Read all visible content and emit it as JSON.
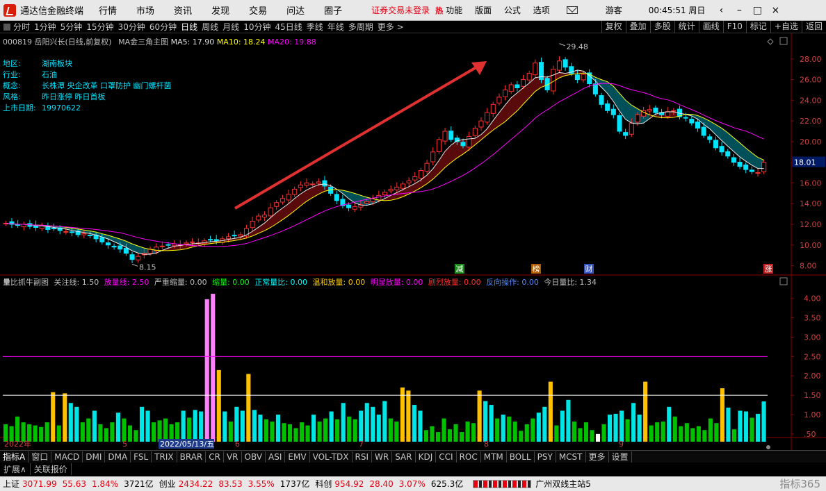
{
  "titlebar": {
    "app_title": "通达信金融终端",
    "menu": [
      "行情",
      "市场",
      "资讯",
      "发现",
      "交易",
      "问达",
      "圈子"
    ],
    "warning": "证券交易未登录",
    "hot_label": "热",
    "tools": [
      "功能",
      "版面",
      "公式",
      "选项"
    ],
    "guest": "游客",
    "clock": "00:45:51 周日",
    "window_buttons": [
      "‹",
      "–",
      "□",
      "×"
    ]
  },
  "periodbar": {
    "periods": [
      "分时",
      "1分钟",
      "5分钟",
      "15分钟",
      "30分钟",
      "60分钟",
      "日线",
      "周线",
      "月线",
      "10分钟",
      "45日线",
      "季线",
      "年线",
      "多周期",
      "更多 >"
    ],
    "selected": "日线",
    "right": [
      "复权",
      "叠加",
      "多股",
      "统计",
      "画线",
      "F10",
      "标记",
      "+自选",
      "返回"
    ]
  },
  "main_header": {
    "code_name": "000819 岳阳兴长(日线,前复权)",
    "indicator": "MA金三角主图",
    "ma5": "MA5: 17.90",
    "ma10": "MA10: 18.24",
    "ma20": "MA20: 19.88"
  },
  "info": [
    {
      "k": "地区:",
      "v": "湖南板块"
    },
    {
      "k": "行业:",
      "v": "石油"
    },
    {
      "k": "概念:",
      "v": "长株潭 央企改革 口罩防护 幽门螺杆菌"
    },
    {
      "k": "风格:",
      "v": "昨日涨停 昨日首板"
    },
    {
      "k": "上市日期:",
      "v": "19970622"
    }
  ],
  "price_axis": [
    "28.00",
    "26.00",
    "24.00",
    "22.00",
    "20.00",
    "18.00",
    "16.00",
    "14.00",
    "12.00",
    "10.00",
    "8.00"
  ],
  "current_price": "18.01",
  "high_mark": "29.48",
  "low_mark": "8.15",
  "event_badges": [
    "减",
    "榜",
    "财",
    "涨"
  ],
  "sub_header": {
    "name": "量比抓牛副图",
    "items": [
      {
        "text": "关注线: 1.50",
        "color": "#c0c0c0"
      },
      {
        "text": "放量线: 2.50",
        "color": "#ff00ff"
      },
      {
        "text": "严重缩量: 0.00",
        "color": "#c0c0c0"
      },
      {
        "text": "缩量: 0.00",
        "color": "#00ff00"
      },
      {
        "text": "正常量比: 0.00",
        "color": "#00ffff"
      },
      {
        "text": "温和放量: 0.00",
        "color": "#ffcc00"
      },
      {
        "text": "明显放量: 0.00",
        "color": "#ff00ff"
      },
      {
        "text": "剧烈放量: 0.00",
        "color": "#ff3030"
      },
      {
        "text": "反向操作: 0.00",
        "color": "#5588ff"
      },
      {
        "text": "今日量比: 1.34",
        "color": "#c0c0c0"
      }
    ]
  },
  "vol_axis": [
    "4.00",
    "3.50",
    "3.00",
    "2.50",
    "2.00",
    "1.50",
    "1.00",
    ".50"
  ],
  "date_axis": [
    "2022年",
    "5",
    "2022/05/13/五",
    "6",
    "7",
    "8",
    "9"
  ],
  "tabs": [
    "指标A",
    "窗口",
    "MACD",
    "DMI",
    "DMA",
    "FSL",
    "TRIX",
    "BRAR",
    "CR",
    "VR",
    "OBV",
    "ASI",
    "EMV",
    "VOL-TDX",
    "RSI",
    "WR",
    "SAR",
    "KDJ",
    "CCI",
    "ROC",
    "MTM",
    "BOLL",
    "PSY",
    "MCST",
    "更多",
    "设置"
  ],
  "ext": [
    "扩展∧",
    "关联报价"
  ],
  "status": {
    "sh_label": "上证",
    "sh_val": "3071.99",
    "sh_chg": "55.63",
    "sh_pct": "1.84%",
    "sh_amt": "3721亿",
    "cy_label": "创业",
    "cy_val": "2434.22",
    "cy_chg": "83.53",
    "cy_pct": "3.55%",
    "cy_amt": "1737亿",
    "kc_label": "科创",
    "kc_val": "954.92",
    "kc_chg": "28.40",
    "kc_pct": "3.07%",
    "kc_amt": "625.3亿",
    "server": "广州双线主站5",
    "watermark": "指标365"
  },
  "chart_data": {
    "type": "candlestick",
    "ylim": [
      7.5,
      29.8
    ],
    "candles_note": "close values (approximate) per trading day, Apr–Sep 2022",
    "closes": [
      12.1,
      12.0,
      11.9,
      12.0,
      11.8,
      11.7,
      11.9,
      11.5,
      11.6,
      11.4,
      11.3,
      11.2,
      11.0,
      11.1,
      10.9,
      10.6,
      10.3,
      10.0,
      9.8,
      9.6,
      9.2,
      8.6,
      8.9,
      9.2,
      9.6,
      9.8,
      9.9,
      10.0,
      10.1,
      10.0,
      10.2,
      10.3,
      10.2,
      10.4,
      10.5,
      10.4,
      10.6,
      10.8,
      10.9,
      11.0,
      11.6,
      12.3,
      12.8,
      12.9,
      13.6,
      14.1,
      14.5,
      14.9,
      15.4,
      15.8,
      16.0,
      15.9,
      16.1,
      15.7,
      15.0,
      14.3,
      13.8,
      13.6,
      13.7,
      13.9,
      14.2,
      14.5,
      14.8,
      15.1,
      15.4,
      15.6,
      15.9,
      16.2,
      16.6,
      17.2,
      17.9,
      19.0,
      20.2,
      21.0,
      20.2,
      20.0,
      19.6,
      20.5,
      21.3,
      22.0,
      22.8,
      23.6,
      24.3,
      25.0,
      25.5,
      25.2,
      26.0,
      26.6,
      27.6,
      26.0,
      25.0,
      27.0,
      27.8,
      27.2,
      26.6,
      26.0,
      26.5,
      25.6,
      24.6,
      23.6,
      23.0,
      22.6,
      21.0,
      20.6,
      21.8,
      22.6,
      23.0,
      23.1,
      22.8,
      22.6,
      22.9,
      23.0,
      22.4,
      22.3,
      21.8,
      21.3,
      20.6,
      20.2,
      19.4,
      19.0,
      18.6,
      18.0,
      17.6,
      17.3,
      17.1,
      17.0,
      18.0
    ],
    "vol_ratio": [
      0.75,
      0.7,
      0.95,
      0.8,
      0.75,
      0.72,
      0.68,
      0.8,
      1.58,
      0.72,
      1.55,
      1.3,
      1.2,
      0.8,
      0.9,
      1.1,
      0.75,
      0.65,
      0.8,
      1.05,
      0.9,
      0.72,
      0.6,
      1.2,
      1.1,
      0.8,
      0.85,
      0.9,
      0.75,
      0.8,
      1.1,
      0.92,
      1.12,
      1.08,
      3.98,
      4.12,
      2.15,
      1.08,
      0.82,
      1.2,
      1.1,
      2.05,
      1.12,
      1.0,
      0.88,
      0.82,
      1.0,
      0.78,
      0.75,
      0.65,
      0.8,
      0.72,
      1.0,
      0.82,
      0.9,
      1.08,
      0.88,
      1.3,
      0.95,
      0.88,
      1.1,
      1.3,
      1.2,
      1.0,
      1.35,
      0.9,
      0.82,
      1.7,
      1.62,
      1.25,
      1.1,
      0.6,
      0.7,
      0.55,
      0.9,
      0.62,
      0.75,
      0.55,
      0.82,
      0.78,
      1.62,
      1.35,
      1.25,
      0.9,
      1.0,
      0.95,
      0.82,
      0.58,
      0.75,
      0.9,
      1.05,
      1.2,
      1.85,
      0.72,
      1.1,
      1.38,
      0.82,
      0.65,
      0.8,
      0.6,
      0.5,
      0.75,
      1.0,
      1.02,
      1.1,
      0.88,
      1.3,
      1.0,
      1.85,
      0.72,
      0.8,
      0.82,
      1.2,
      0.95,
      0.7,
      0.78,
      0.65,
      0.7,
      0.6,
      0.9,
      0.78,
      1.68,
      1.18,
      0.62,
      1.1,
      1.08,
      0.92,
      1.02,
      1.34
    ],
    "lines": [
      1.5,
      2.5
    ]
  }
}
